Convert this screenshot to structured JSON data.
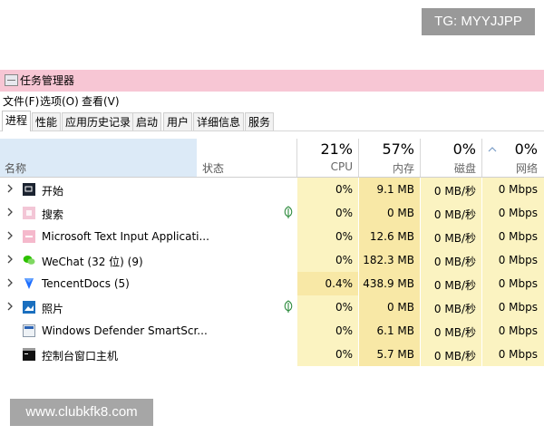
{
  "overlays": {
    "tg": "TG: MYYJJPP",
    "url": "www.clubkfk8.com"
  },
  "window": {
    "title": "任务管理器"
  },
  "menu": [
    "文件(F)",
    "选项(O)",
    "查看(V)"
  ],
  "tabs": [
    "进程",
    "性能",
    "应用历史记录",
    "启动",
    "用户",
    "详细信息",
    "服务"
  ],
  "active_tab": "进程",
  "columns": {
    "name": "名称",
    "status": "状态",
    "cpu": {
      "label": "CPU",
      "pct": "21%"
    },
    "memory": {
      "label": "内存",
      "pct": "57%"
    },
    "disk": {
      "label": "磁盘",
      "pct": "0%"
    },
    "network": {
      "label": "网络",
      "pct": "0%"
    }
  },
  "processes": [
    {
      "name": "开始",
      "icon": "start-icon",
      "expandable": true,
      "status_icon": "",
      "cpu": "0%",
      "memory": "9.1 MB",
      "disk": "0 MB/秒",
      "network": "0 Mbps"
    },
    {
      "name": "搜索",
      "icon": "search-app-icon",
      "expandable": true,
      "status_icon": "leaf-icon",
      "cpu": "0%",
      "memory": "0 MB",
      "disk": "0 MB/秒",
      "network": "0 Mbps"
    },
    {
      "name": "Microsoft Text Input Applicati...",
      "icon": "text-input-icon",
      "expandable": true,
      "status_icon": "",
      "cpu": "0%",
      "memory": "12.6 MB",
      "disk": "0 MB/秒",
      "network": "0 Mbps"
    },
    {
      "name": "WeChat (32 位) (9)",
      "icon": "wechat-icon",
      "expandable": true,
      "status_icon": "",
      "cpu": "0%",
      "memory": "182.3 MB",
      "disk": "0 MB/秒",
      "network": "0 Mbps"
    },
    {
      "name": "TencentDocs (5)",
      "icon": "tencent-docs-icon",
      "expandable": true,
      "status_icon": "",
      "cpu": "0.4%",
      "memory": "438.9 MB",
      "disk": "0 MB/秒",
      "network": "0 Mbps"
    },
    {
      "name": "照片",
      "icon": "photos-icon",
      "expandable": true,
      "status_icon": "leaf-icon",
      "cpu": "0%",
      "memory": "0 MB",
      "disk": "0 MB/秒",
      "network": "0 Mbps"
    },
    {
      "name": "Windows Defender SmartScr...",
      "icon": "defender-icon",
      "expandable": false,
      "status_icon": "",
      "cpu": "0%",
      "memory": "6.1 MB",
      "disk": "0 MB/秒",
      "network": "0 Mbps"
    },
    {
      "name": "控制台窗口主机",
      "icon": "console-icon",
      "expandable": false,
      "status_icon": "",
      "cpu": "0%",
      "memory": "5.7 MB",
      "disk": "0 MB/秒",
      "network": "0 Mbps"
    }
  ],
  "colors": {
    "title_bar": "#f7c6d4",
    "cell_light": "#fbf3c1",
    "cell_highlight": "#f8e8a6",
    "name_header": "#dceaf7"
  }
}
